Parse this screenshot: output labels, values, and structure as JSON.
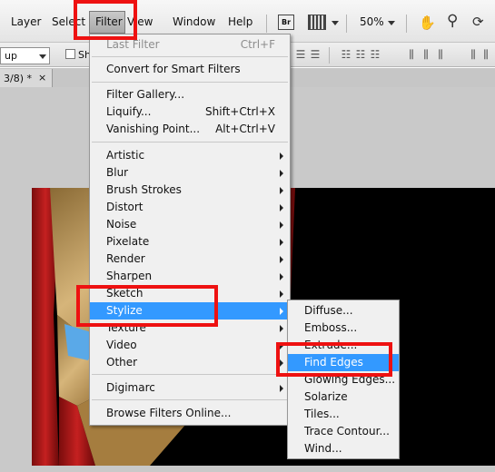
{
  "menubar": {
    "items": [
      "Layer",
      "Select",
      "Filter",
      "View",
      "Window",
      "Help"
    ],
    "bridge_label": "Br",
    "zoom": "50%"
  },
  "options_bar": {
    "select_value": "up",
    "checkbox_label": "Sh"
  },
  "document_tab": {
    "label": "3/8) *",
    "close": "×"
  },
  "filter_menu": {
    "last_filter": {
      "label": "Last Filter",
      "shortcut": "Ctrl+F"
    },
    "convert_smart": "Convert for Smart Filters",
    "filter_gallery": "Filter Gallery...",
    "liquify": {
      "label": "Liquify...",
      "shortcut": "Shift+Ctrl+X"
    },
    "vanishing_point": {
      "label": "Vanishing Point...",
      "shortcut": "Alt+Ctrl+V"
    },
    "categories": [
      "Artistic",
      "Blur",
      "Brush Strokes",
      "Distort",
      "Noise",
      "Pixelate",
      "Render",
      "Sharpen",
      "Sketch",
      "Stylize",
      "Texture",
      "Video",
      "Other"
    ],
    "digimarc": "Digimarc",
    "browse_online": "Browse Filters Online..."
  },
  "stylize_submenu": {
    "items": [
      "Diffuse...",
      "Emboss...",
      "Extrude...",
      "Find Edges",
      "Glowing Edges...",
      "Solarize",
      "Tiles...",
      "Trace Contour...",
      "Wind..."
    ]
  },
  "colors": {
    "highlight": "#3399ff",
    "annotation": "#ee1111"
  }
}
